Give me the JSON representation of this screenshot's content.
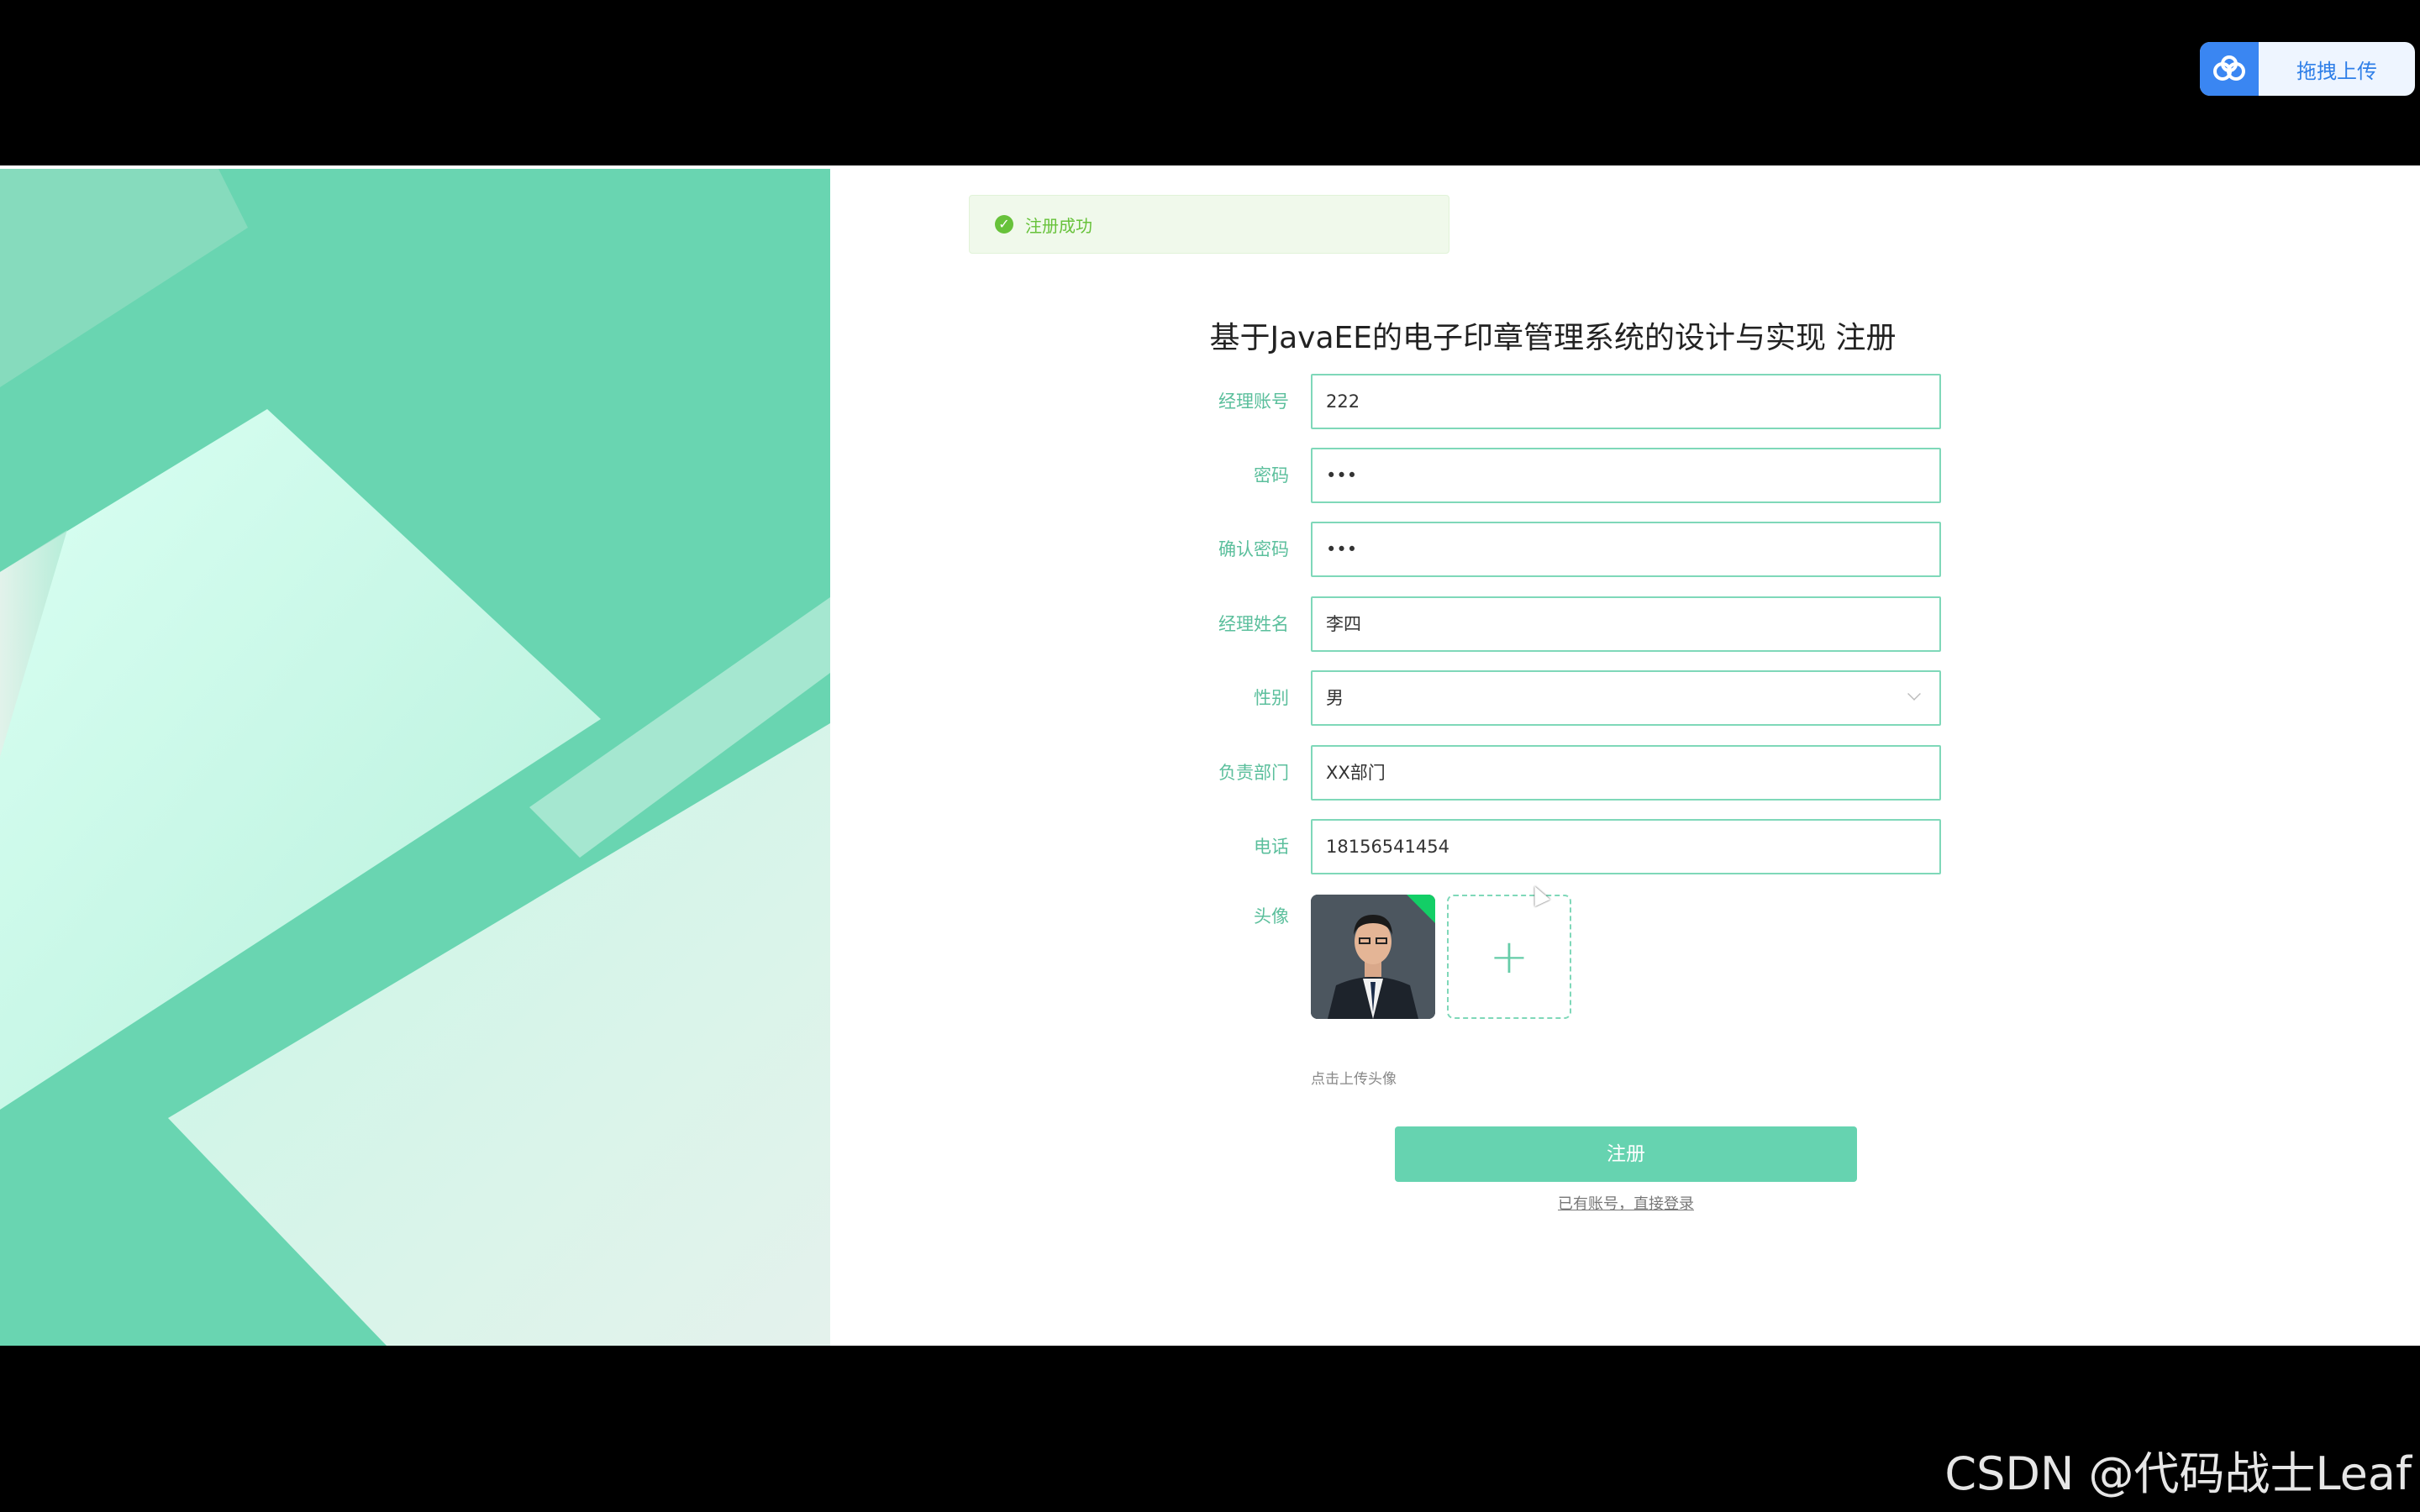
{
  "upload_widget": {
    "icon": "cloud-icon",
    "label": "拖拽上传"
  },
  "message": {
    "icon": "check-circle-icon",
    "text": "注册成功"
  },
  "form": {
    "title": "基于JavaEE的电子印章管理系统的设计与实现 注册",
    "fields": [
      {
        "label": "经理账号",
        "value": "222"
      },
      {
        "label": "密码",
        "value": "•••"
      },
      {
        "label": "确认密码",
        "value": "•••"
      },
      {
        "label": "经理姓名",
        "value": "李四"
      },
      {
        "label": "性别",
        "value": "男"
      },
      {
        "label": "负责部门",
        "value": "XX部门"
      },
      {
        "label": "电话",
        "value": "18156541454"
      }
    ],
    "avatar_label": "头像",
    "avatar_add": "+",
    "upload_tip": "点击上传头像",
    "submit_label": "注册",
    "login_link": "已有账号，直接登录"
  },
  "watermark": "CSDN @代码战士Leaf",
  "colors": {
    "accent": "#66d3b0",
    "success": "#67c23a"
  }
}
